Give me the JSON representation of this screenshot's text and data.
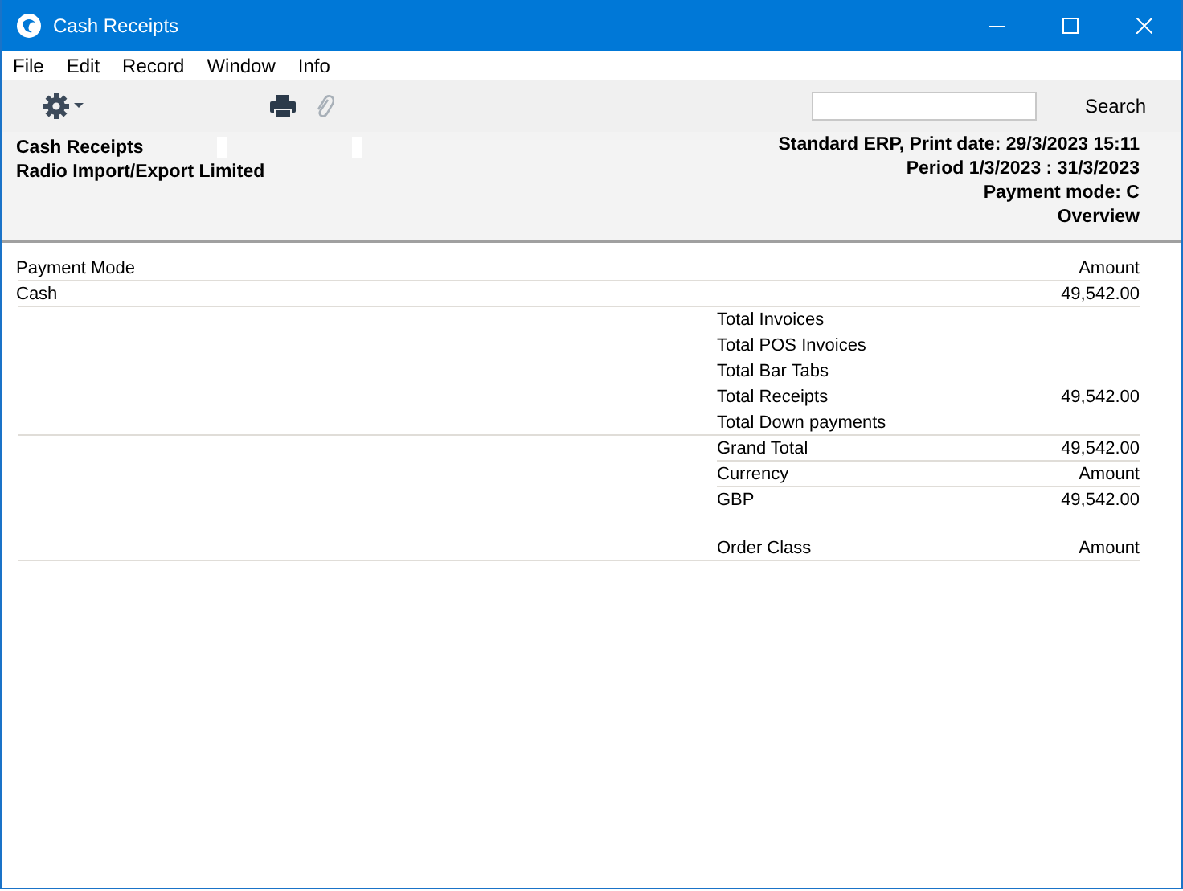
{
  "window": {
    "title": "Cash Receipts"
  },
  "menu": [
    "File",
    "Edit",
    "Record",
    "Window",
    "Info"
  ],
  "toolbar": {
    "attachment_disabled": true,
    "search": {
      "button": "Search"
    }
  },
  "header": {
    "left": [
      "Cash Receipts",
      "Radio Import/Export Limited"
    ],
    "right": [
      "Standard ERP, Print date: 29/3/2023 15:11",
      "Period  1/3/2023 : 31/3/2023",
      "Payment mode:  C",
      "Overview"
    ]
  },
  "report": {
    "payment_modes": {
      "columns": [
        "Payment Mode",
        "Amount"
      ],
      "rows": [
        [
          "Cash",
          "49,542.00"
        ]
      ]
    },
    "totals": [
      {
        "label": "Total Invoices"
      },
      {
        "label": "Total POS Invoices"
      },
      {
        "label": "Total Bar Tabs"
      },
      {
        "label": "Total Receipts",
        "amount": "49,542.00"
      },
      {
        "label": "Total Down payments"
      }
    ],
    "grand_total": {
      "label": "Grand Total",
      "amount": "49,542.00"
    },
    "currencies": {
      "columns": [
        "Currency",
        "Amount"
      ],
      "rows": [
        [
          "GBP",
          "49,542.00"
        ]
      ]
    },
    "order_classes": {
      "columns": [
        "Order Class",
        "Amount"
      ]
    }
  }
}
